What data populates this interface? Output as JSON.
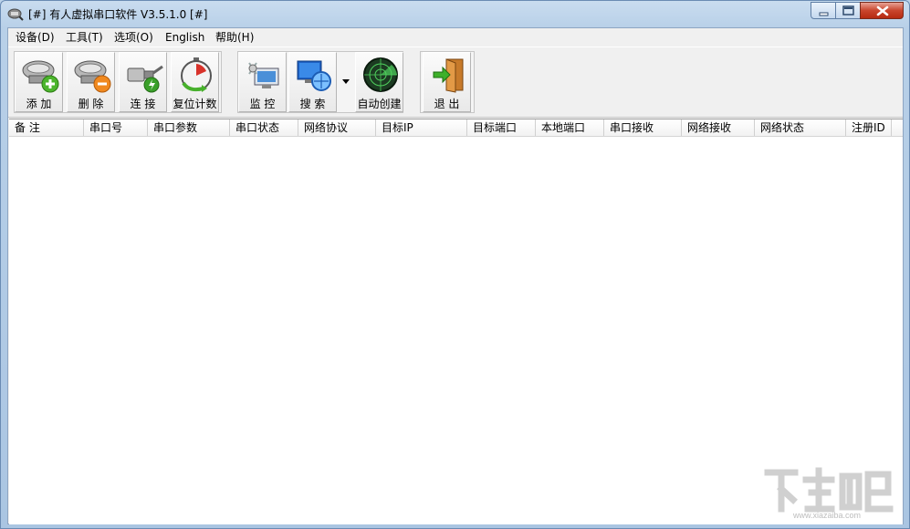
{
  "window": {
    "title": "[#] 有人虚拟串口软件 V3.5.1.0 [#]"
  },
  "menu": [
    {
      "label": "设备(D)"
    },
    {
      "label": "工具(T)"
    },
    {
      "label": "选项(O)"
    },
    {
      "label": "English"
    },
    {
      "label": "帮助(H)"
    }
  ],
  "toolbar": {
    "add": "添 加",
    "delete": "删 除",
    "connect": "连 接",
    "reset_count": "复位计数",
    "monitor": "监 控",
    "search": "搜 索",
    "auto_create": "自动创建",
    "exit": "退 出"
  },
  "table": {
    "columns": [
      {
        "label": "备 注"
      },
      {
        "label": "串口号"
      },
      {
        "label": "串口参数"
      },
      {
        "label": "串口状态"
      },
      {
        "label": "网络协议"
      },
      {
        "label": "目标IP"
      },
      {
        "label": "目标端口"
      },
      {
        "label": "本地端口"
      },
      {
        "label": "串口接收"
      },
      {
        "label": "网络接收"
      },
      {
        "label": "网络状态"
      },
      {
        "label": "注册ID"
      }
    ],
    "rows": []
  },
  "icons": {
    "app": "serial-plug-icon",
    "add": "serial-add-icon",
    "delete": "serial-delete-icon",
    "connect": "connector-icon",
    "reset": "stopwatch-icon",
    "monitor": "monitor-icon",
    "search": "network-search-icon",
    "auto_create": "radar-icon",
    "exit": "exit-door-icon"
  },
  "watermark": {
    "site": "www.xiazaiba.com"
  },
  "colors": {
    "client_bg": "#f0f0f0",
    "close_button": "#c9452d",
    "title_gradient": "#c9dcef"
  }
}
